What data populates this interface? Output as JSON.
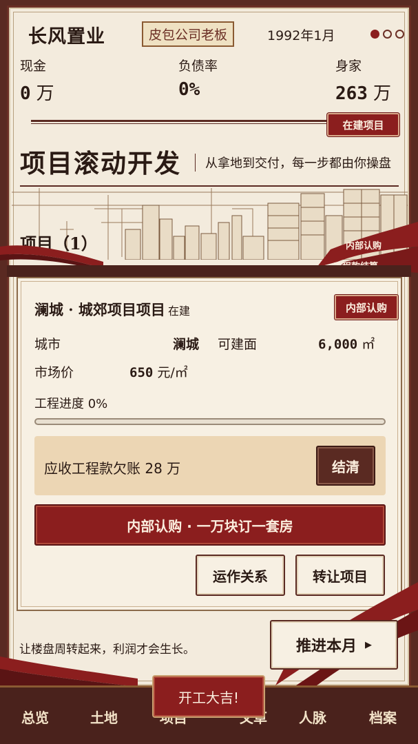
{
  "header": {
    "company": "长风置业",
    "title_badge": "皮包公司老板",
    "date": "1992年1月"
  },
  "stats": [
    {
      "label": "现金",
      "value": "0",
      "unit": "万"
    },
    {
      "label": "负债率",
      "value": "0%"
    },
    {
      "label": "身家",
      "value": "263",
      "unit": "万"
    }
  ],
  "section": {
    "tag": "在建项目",
    "title": "项目滚动开发",
    "subtitle": "从拿地到交付，每一步都由你操盘",
    "projects_heading": "项目（1）"
  },
  "ribbon_tags": [
    "内部认购",
    "工程款结算"
  ],
  "project": {
    "name": "澜城 · 城郊项目项目",
    "status": "在建",
    "tag": "内部认购",
    "city_label": "城市",
    "city_value": "澜城",
    "area_label": "可建面",
    "area_value": "6,000",
    "area_unit": "㎡",
    "price_label": "市场价",
    "price_value": "650",
    "price_unit": "元/㎡",
    "progress_text": "工程进度 0%",
    "progress": 0,
    "receivable_text": "应收工程款欠账 28 万",
    "settle_label": "结清",
    "primary_action": "内部认购 · 一万块订一套房",
    "relations_label": "运作关系",
    "transfer_label": "转让项目"
  },
  "footer": {
    "hint": "让楼盘周转起来，利润才会生长。",
    "advance_label": "推进本月",
    "advance_icon": "play-triangle-icon",
    "start_label": "开工大吉!"
  },
  "nav": [
    "总览",
    "土地",
    "项目",
    "文草",
    "人脉",
    "档案"
  ],
  "colors": {
    "accent_red": "#8b1e1e",
    "dark_brown": "#5a2a22",
    "paper": "#f3ebdd"
  }
}
